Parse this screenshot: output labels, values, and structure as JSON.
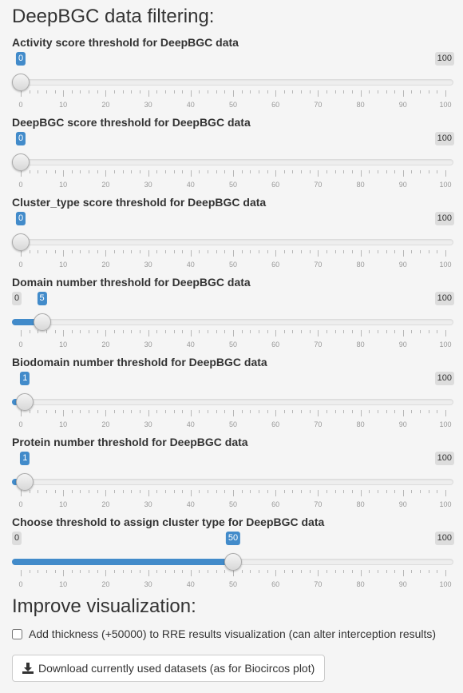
{
  "heading": "DeepBGC data filtering:",
  "sliders": [
    {
      "label": "Activity score threshold for DeepBGC data",
      "min": 0,
      "max": 100,
      "value": 0,
      "min_label": "0",
      "max_label": "100",
      "value_label": "0"
    },
    {
      "label": "DeepBGC score threshold for DeepBGC data",
      "min": 0,
      "max": 100,
      "value": 0,
      "min_label": "0",
      "max_label": "100",
      "value_label": "0"
    },
    {
      "label": "Cluster_type score threshold for DeepBGC data",
      "min": 0,
      "max": 100,
      "value": 0,
      "min_label": "0",
      "max_label": "100",
      "value_label": "0"
    },
    {
      "label": "Domain number threshold for DeepBGC data",
      "min": 0,
      "max": 100,
      "value": 5,
      "min_label": "0",
      "max_label": "100",
      "value_label": "5"
    },
    {
      "label": "Biodomain number threshold for DeepBGC data",
      "min": 0,
      "max": 100,
      "value": 1,
      "min_label": "0",
      "max_label": "100",
      "value_label": "1"
    },
    {
      "label": "Protein number threshold for DeepBGC data",
      "min": 0,
      "max": 100,
      "value": 1,
      "min_label": "0",
      "max_label": "100",
      "value_label": "1"
    },
    {
      "label": "Choose threshold to assign cluster type for DeepBGC data",
      "min": 0,
      "max": 100,
      "value": 50,
      "min_label": "0",
      "max_label": "100",
      "value_label": "50"
    }
  ],
  "tick_labels": [
    "0",
    "10",
    "20",
    "30",
    "40",
    "50",
    "60",
    "70",
    "80",
    "90",
    "100"
  ],
  "improve_heading": "Improve visualization:",
  "checkbox_label": "Add thickness (+50000) to RRE results visualization (can alter interception results)",
  "checkbox_checked": false,
  "download_label": "Download currently used datasets (as for Biocircos plot)",
  "download_icon": "download-icon",
  "accent_color": "#428bca"
}
